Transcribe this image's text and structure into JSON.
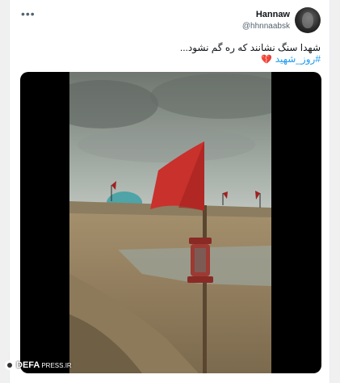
{
  "tweet": {
    "display_name": "Hannaw",
    "handle": "@hhnnaabsk",
    "text": "شهدا سنگ نشانند که ره گم نشود...",
    "hashtag": "#روز_شهید",
    "more_icon": "more-horizontal-icon",
    "heart_icon": "broken-heart-icon"
  },
  "media": {
    "type": "video-frame",
    "description_icon": "red-flag-lantern-photo"
  },
  "watermark": {
    "brand": "DEFA",
    "suffix": "PRESS.IR"
  }
}
